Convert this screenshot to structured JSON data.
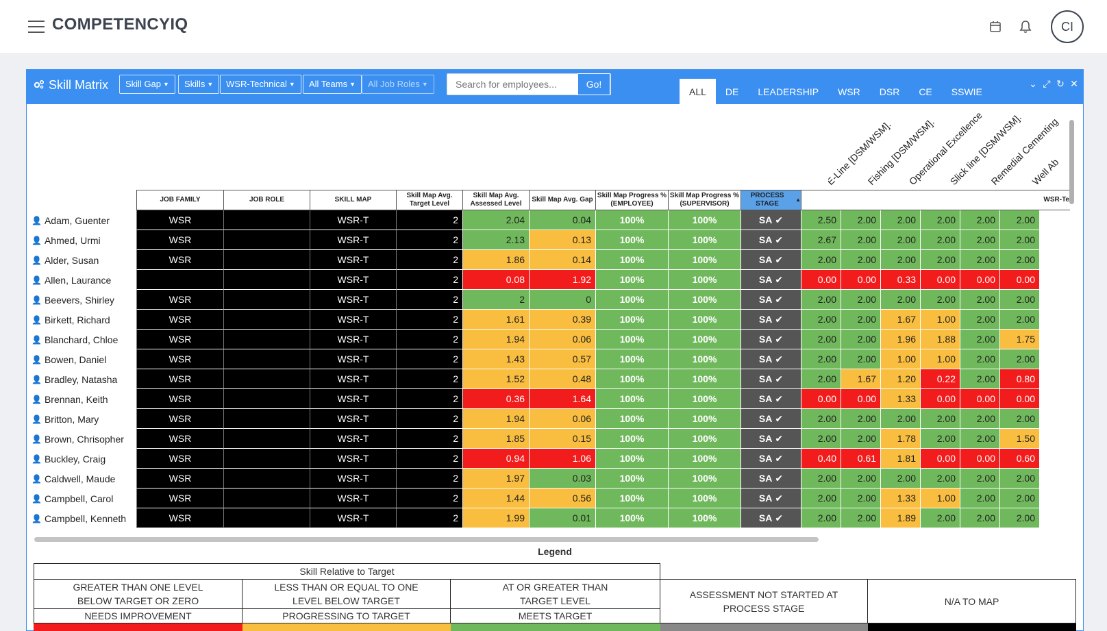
{
  "app": {
    "brand": "COMPETENCYIQ",
    "avatar": "CI"
  },
  "panel": {
    "title": "Skill Matrix",
    "filters": [
      "Skill Gap",
      "Skills",
      "WSR-Technical",
      "All Teams",
      "All Job Roles"
    ],
    "search_placeholder": "Search for employees...",
    "go_label": "Go!",
    "tabs": [
      "ALL",
      "DE",
      "LEADERSHIP",
      "WSR",
      "DSR",
      "CE",
      "SSWIE"
    ]
  },
  "diagonal_headers": [
    "E-Line [DSM/WSM].",
    "Fishing [DSM/WSM].",
    "Operational Excellence",
    "Slick line [DSM/WSM].",
    "Remedial Cementing",
    "Well Ab"
  ],
  "columns": {
    "job_family": "JOB FAMILY",
    "job_role": "JOB ROLE",
    "skill_map": "SKILL MAP",
    "target": "Skill Map Avg. Target Level",
    "assessed": "Skill Map Avg. Assessed Level",
    "gap": "Skill Map Avg. Gap",
    "prog_emp": "Skill Map Progress % (EMPLOYEE)",
    "prog_sup": "Skill Map Progress % (SUPERVISOR)",
    "process": "PROCESS STAGE",
    "group": "WSR-Te"
  },
  "rows": [
    {
      "name": "Adam, Guenter",
      "family": "WSR",
      "map": "WSR-T",
      "target": "2",
      "assessed": "2.04",
      "gap": "0.04",
      "pe": "100%",
      "ps": "100%",
      "stage": "SA",
      "skills": [
        "2.50",
        "2.00",
        "2.00",
        "2.00",
        "2.00",
        "2.00"
      ]
    },
    {
      "name": "Ahmed, Urmi",
      "family": "WSR",
      "map": "WSR-T",
      "target": "2",
      "assessed": "2.13",
      "gap": "0.13",
      "pe": "100%",
      "ps": "100%",
      "stage": "SA",
      "skills": [
        "2.67",
        "2.00",
        "2.00",
        "2.00",
        "2.00",
        "2.00"
      ]
    },
    {
      "name": "Alder, Susan",
      "family": "WSR",
      "map": "WSR-T",
      "target": "2",
      "assessed": "1.86",
      "gap": "0.14",
      "pe": "100%",
      "ps": "100%",
      "stage": "SA",
      "skills": [
        "2.00",
        "2.00",
        "2.00",
        "2.00",
        "2.00",
        "2.00"
      ]
    },
    {
      "name": "Allen, Laurance",
      "family": "",
      "map": "WSR-T",
      "target": "2",
      "assessed": "0.08",
      "gap": "1.92",
      "pe": "100%",
      "ps": "100%",
      "stage": "SA",
      "skills": [
        "0.00",
        "0.00",
        "0.33",
        "0.00",
        "0.00",
        "0.00"
      ]
    },
    {
      "name": "Beevers, Shirley",
      "family": "WSR",
      "map": "WSR-T",
      "target": "2",
      "assessed": "2",
      "gap": "0",
      "pe": "100%",
      "ps": "100%",
      "stage": "SA",
      "skills": [
        "2.00",
        "2.00",
        "2.00",
        "2.00",
        "2.00",
        "2.00"
      ]
    },
    {
      "name": "Birkett, Richard",
      "family": "WSR",
      "map": "WSR-T",
      "target": "2",
      "assessed": "1.61",
      "gap": "0.39",
      "pe": "100%",
      "ps": "100%",
      "stage": "SA",
      "skills": [
        "2.00",
        "2.00",
        "1.67",
        "1.00",
        "2.00",
        "2.00"
      ]
    },
    {
      "name": "Blanchard, Chloe",
      "family": "WSR",
      "map": "WSR-T",
      "target": "2",
      "assessed": "1.94",
      "gap": "0.06",
      "pe": "100%",
      "ps": "100%",
      "stage": "SA",
      "skills": [
        "2.00",
        "2.00",
        "1.96",
        "1.88",
        "2.00",
        "1.75"
      ]
    },
    {
      "name": "Bowen, Daniel",
      "family": "WSR",
      "map": "WSR-T",
      "target": "2",
      "assessed": "1.43",
      "gap": "0.57",
      "pe": "100%",
      "ps": "100%",
      "stage": "SA",
      "skills": [
        "2.00",
        "2.00",
        "1.00",
        "1.00",
        "2.00",
        "2.00"
      ]
    },
    {
      "name": "Bradley, Natasha",
      "family": "WSR",
      "map": "WSR-T",
      "target": "2",
      "assessed": "1.52",
      "gap": "0.48",
      "pe": "100%",
      "ps": "100%",
      "stage": "SA",
      "skills": [
        "2.00",
        "1.67",
        "1.20",
        "0.22",
        "2.00",
        "0.80"
      ]
    },
    {
      "name": "Brennan, Keith",
      "family": "WSR",
      "map": "WSR-T",
      "target": "2",
      "assessed": "0.36",
      "gap": "1.64",
      "pe": "100%",
      "ps": "100%",
      "stage": "SA",
      "skills": [
        "0.00",
        "0.00",
        "1.33",
        "0.00",
        "0.00",
        "0.00"
      ]
    },
    {
      "name": "Britton, Mary",
      "family": "WSR",
      "map": "WSR-T",
      "target": "2",
      "assessed": "1.94",
      "gap": "0.06",
      "pe": "100%",
      "ps": "100%",
      "stage": "SA",
      "skills": [
        "2.00",
        "2.00",
        "2.00",
        "2.00",
        "2.00",
        "2.00"
      ]
    },
    {
      "name": "Brown, Chrisopher",
      "family": "WSR",
      "map": "WSR-T",
      "target": "2",
      "assessed": "1.85",
      "gap": "0.15",
      "pe": "100%",
      "ps": "100%",
      "stage": "SA",
      "skills": [
        "2.00",
        "2.00",
        "1.78",
        "2.00",
        "2.00",
        "1.50"
      ]
    },
    {
      "name": "Buckley, Craig",
      "family": "WSR",
      "map": "WSR-T",
      "target": "2",
      "assessed": "0.94",
      "gap": "1.06",
      "pe": "100%",
      "ps": "100%",
      "stage": "SA",
      "skills": [
        "0.40",
        "0.61",
        "1.81",
        "0.00",
        "0.00",
        "0.60"
      ]
    },
    {
      "name": "Caldwell, Maude",
      "family": "WSR",
      "map": "WSR-T",
      "target": "2",
      "assessed": "1.97",
      "gap": "0.03",
      "pe": "100%",
      "ps": "100%",
      "stage": "SA",
      "skills": [
        "2.00",
        "2.00",
        "2.00",
        "2.00",
        "2.00",
        "2.00"
      ]
    },
    {
      "name": "Campbell, Carol",
      "family": "WSR",
      "map": "WSR-T",
      "target": "2",
      "assessed": "1.44",
      "gap": "0.56",
      "pe": "100%",
      "ps": "100%",
      "stage": "SA",
      "skills": [
        "2.00",
        "2.00",
        "1.33",
        "1.00",
        "2.00",
        "2.00"
      ]
    },
    {
      "name": "Campbell, Kenneth",
      "family": "WSR",
      "map": "WSR-T",
      "target": "2",
      "assessed": "1.99",
      "gap": "0.01",
      "pe": "100%",
      "ps": "100%",
      "stage": "SA",
      "skills": [
        "2.00",
        "2.00",
        "1.89",
        "2.00",
        "2.00",
        "2.00"
      ]
    }
  ],
  "legend": {
    "title": "Legend",
    "group_title": "Skill Relative to Target",
    "c1_desc": "GREATER THAN ONE LEVEL BELOW TARGET OR ZERO",
    "c1_label": "NEEDS IMPROVEMENT",
    "c2_desc": "LESS THAN OR EQUAL TO ONE LEVEL BELOW TARGET",
    "c2_label": "PROGRESSING TO TARGET",
    "c3_desc": "AT OR GREATER THAN TARGET LEVEL",
    "c3_label": "MEETS TARGET",
    "c4": "ASSESSMENT NOT STARTED AT PROCESS STAGE",
    "c5": "N/A TO MAP"
  },
  "colors": {
    "primary": "#3b8ff0",
    "red": "#f21c1c",
    "yellow": "#f9bd3f",
    "green": "#70b85c",
    "black": "#000000",
    "gray": "#555555"
  }
}
